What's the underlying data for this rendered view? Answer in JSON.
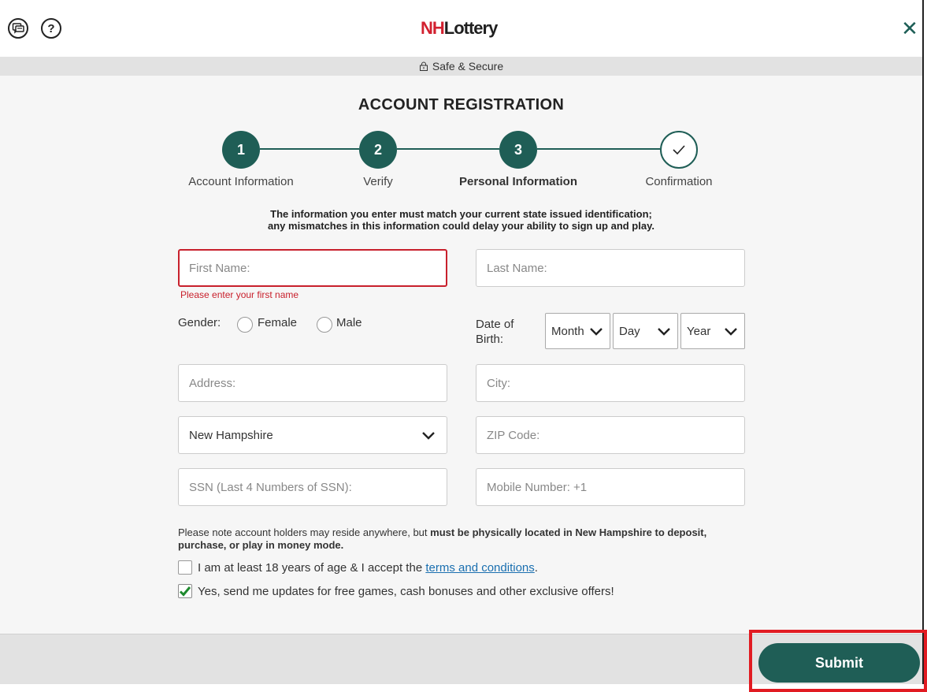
{
  "header": {
    "logo_nh": "NH",
    "logo_lottery": "Lottery",
    "chat_icon": "chat-icon",
    "help_label": "?",
    "close_label": "✕"
  },
  "secure_bar": {
    "text": "Safe & Secure"
  },
  "form": {
    "title": "ACCOUNT REGISTRATION",
    "steps": [
      {
        "number": "1",
        "label": "Account Information"
      },
      {
        "number": "2",
        "label": "Verify"
      },
      {
        "number": "3",
        "label": "Personal Information"
      },
      {
        "number": "",
        "label": "Confirmation"
      }
    ],
    "notice_line1": "The information you enter must match your current state issued identification;",
    "notice_line2": "any mismatches in this information could delay your ability to sign up and play.",
    "first_name_placeholder": "First Name:",
    "first_name_error": "Please enter your first name",
    "last_name_placeholder": "Last Name:",
    "gender_label": "Gender:",
    "gender_female": "Female",
    "gender_male": "Male",
    "dob_label_1": "Date of",
    "dob_label_2": "Birth:",
    "dob_month": "Month",
    "dob_day": "Day",
    "dob_year": "Year",
    "address_placeholder": "Address:",
    "city_placeholder": "City:",
    "state_value": "New Hampshire",
    "zip_placeholder": "ZIP Code:",
    "ssn_placeholder": "SSN (Last 4 Numbers of SSN):",
    "mobile_placeholder": "Mobile Number: +1",
    "note_plain": "Please note account holders may reside anywhere, but ",
    "note_bold": "must be physically located in New Hampshire to deposit, purchase, or play in money mode.",
    "age_check_text": "I am at least 18 years of age & I accept the ",
    "age_check_link": "terms and conditions",
    "age_check_end": ".",
    "updates_check_text": "Yes, send me updates for free games, cash bonuses and other exclusive offers!"
  },
  "footer": {
    "submit_label": "Submit"
  },
  "colors": {
    "primary": "#1f5e56",
    "error": "#c8202c",
    "brand_red": "#d2202f",
    "highlight": "#e11b22"
  }
}
